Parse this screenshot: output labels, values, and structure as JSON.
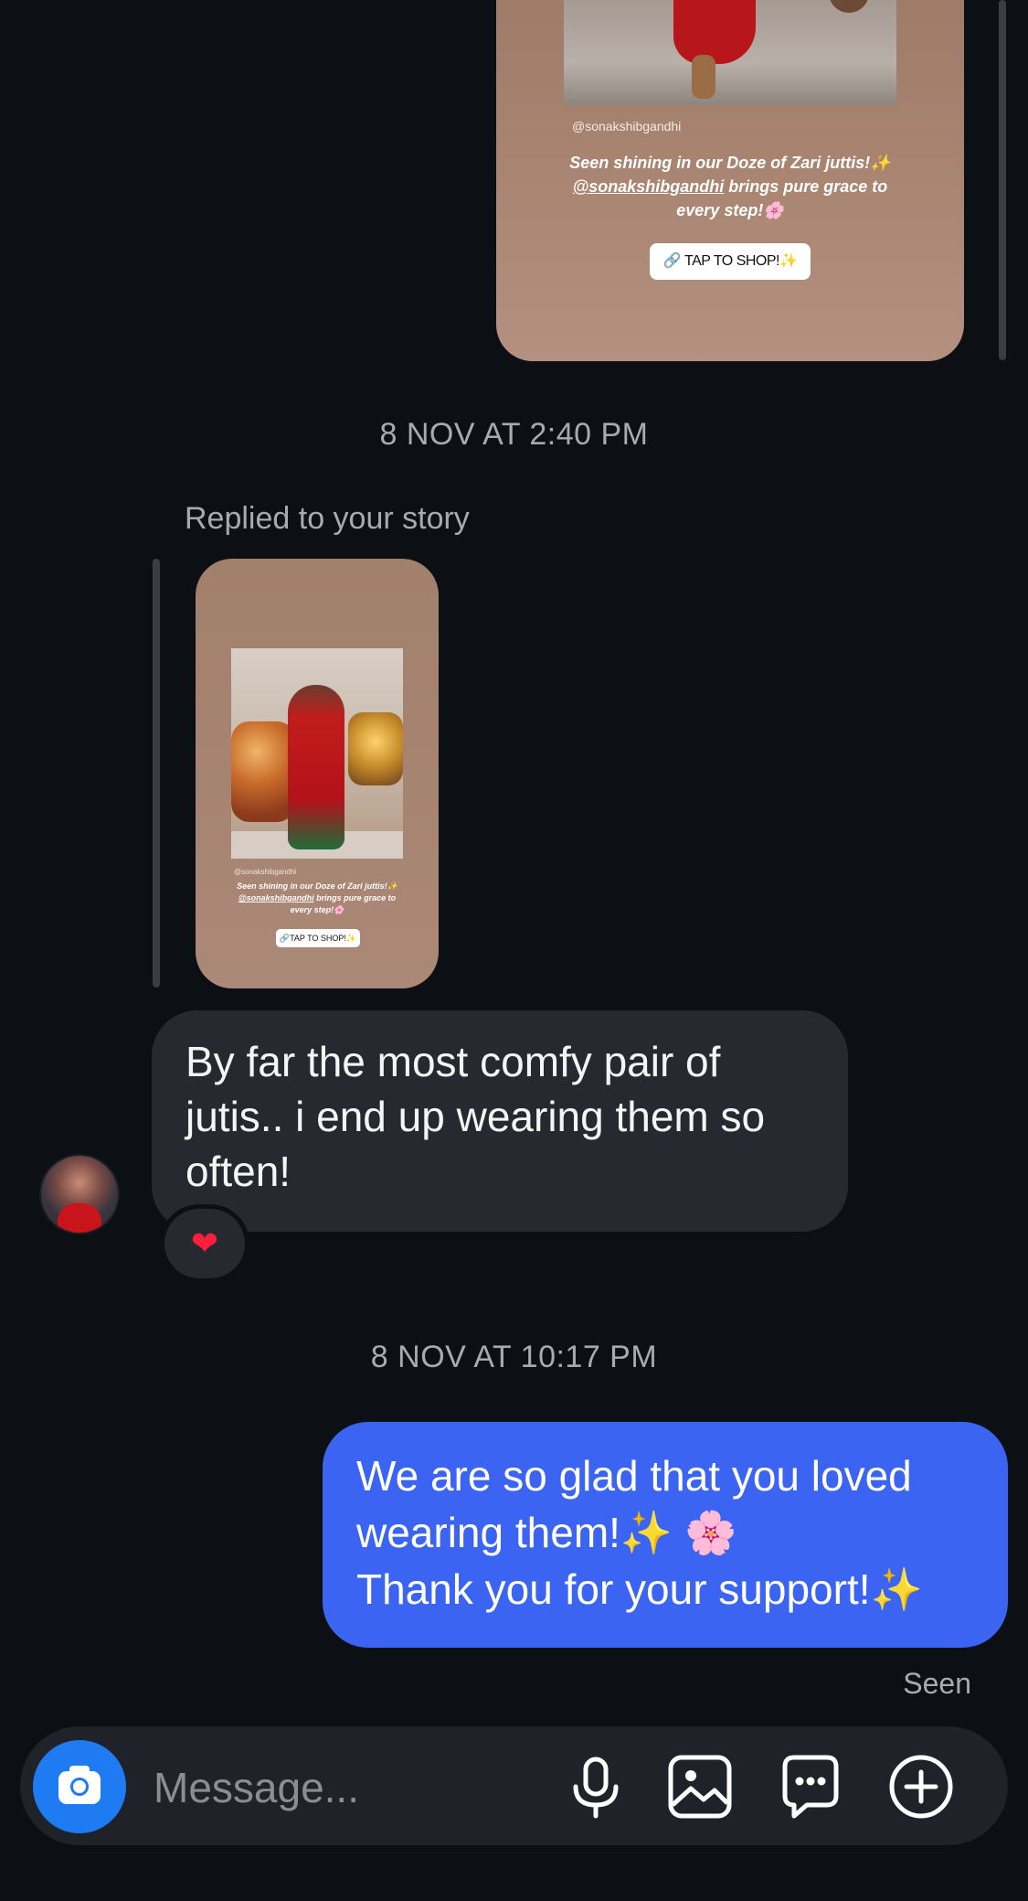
{
  "story_top": {
    "handle": "@sonakshibgandhi",
    "caption_line1": "Seen shining in our Doze of Zari juttis!✨",
    "caption_mention": "@sonakshibgandhi",
    "caption_line2_rest": " brings pure grace to",
    "caption_line3": "every step!🌸",
    "shop_label": "TAP TO SHOP!✨"
  },
  "thread": {
    "timestamp_1": "8 NOV AT 2:40 PM",
    "replied_label": "Replied to your story",
    "story_small": {
      "handle": "@sonakshibgandhi",
      "caption_line1": "Seen shining in our Doze of Zari juttis!✨",
      "caption_mention": "@sonakshibgandhi",
      "caption_line2_rest": " brings pure grace to",
      "caption_line3": "every step!🌸",
      "shop_label": "TAP TO SHOP!✨"
    },
    "incoming_message": {
      "line1": "By far the most comfy pair of",
      "line2": "jutis.. i end up wearing them so",
      "line3": "often!"
    },
    "reaction": "❤",
    "timestamp_2": "8 NOV AT 10:17 PM",
    "outgoing_message": {
      "line1": "We are so glad that you loved",
      "line2_text": "wearing them!",
      "line2_spark": "✨",
      "line2_blossom": "🌸",
      "line3_text": "Thank you for your support!",
      "line3_spark": "✨"
    },
    "seen_label": "Seen"
  },
  "composer": {
    "placeholder": "Message...",
    "icons": [
      "camera-icon",
      "microphone-icon",
      "gallery-icon",
      "sticker-chat-icon",
      "add-plus-icon"
    ]
  },
  "colors": {
    "background": "#0c1014",
    "incoming_bubble": "#262a30",
    "outgoing_bubble": "#3b64f2",
    "camera_button": "#1f7bf2",
    "reaction_heart": "#ff1f3d"
  }
}
